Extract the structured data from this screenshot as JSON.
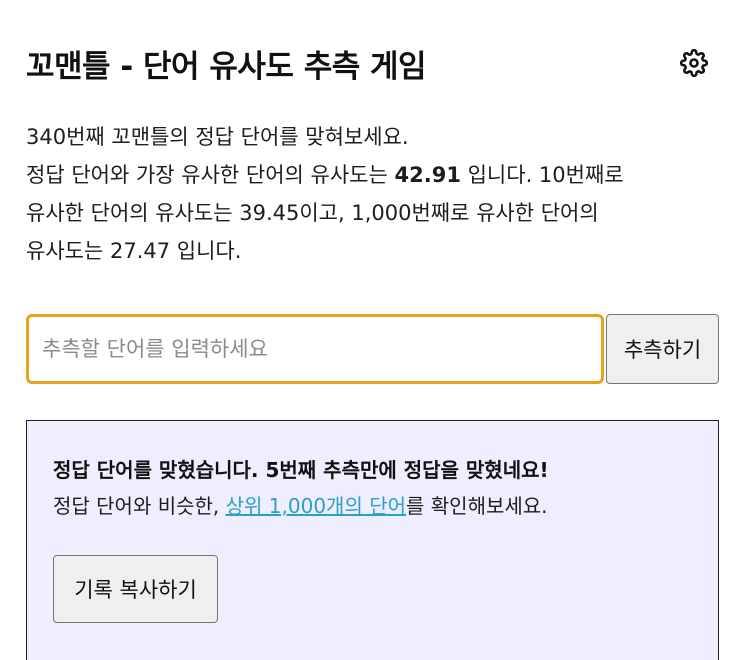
{
  "header": {
    "title": "꼬맨틀 - 단어 유사도 추측 게임",
    "settings_icon": "gear-icon"
  },
  "intro": {
    "line1": "340번째 꼬맨틀의 정답 단어를 맞혀보세요.",
    "line2_prefix": "정답 단어와 가장 유사한 단어의 유사도는 ",
    "top_similarity": "42.91",
    "line2_suffix": " 입니다. 10번째로",
    "line3": "유사한 단어의 유사도는 39.45이고, 1,000번째로 유사한 단어의",
    "line4": "유사도는 27.47 입니다."
  },
  "guess": {
    "placeholder": "추측할 단어를 입력하세요",
    "value": "",
    "button_label": "추측하기"
  },
  "result": {
    "title": "정답 단어를 맞혔습니다. 5번째 추측만에 정답을 맞혔네요!",
    "text_prefix": "정답 단어와 비슷한, ",
    "link_label": "상위 1,000개의 단어",
    "text_suffix": "를 확인해보세요.",
    "copy_button_label": "기록 복사하기"
  },
  "colors": {
    "input_border": "#e6a21b",
    "result_background": "#eeeeff",
    "link": "#2aa0c8"
  }
}
